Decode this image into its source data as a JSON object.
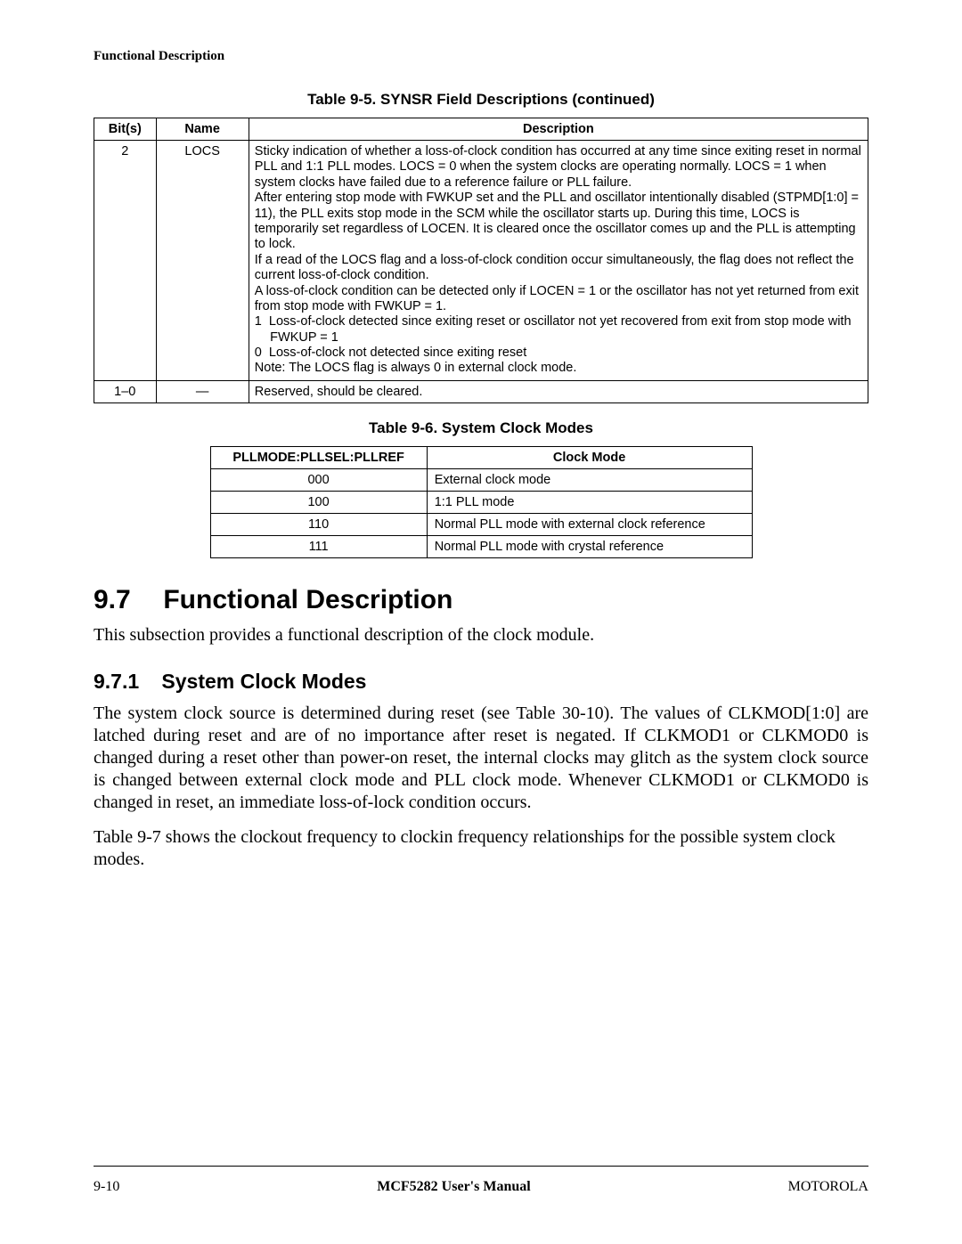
{
  "running_head": "Functional Description",
  "table5": {
    "caption": "Table 9-5. SYNSR Field Descriptions (continued)",
    "headers": {
      "bits": "Bit(s)",
      "name": "Name",
      "desc": "Description"
    },
    "rows": [
      {
        "bits": "2",
        "name": "LOCS",
        "desc": {
          "p1": "Sticky indication of whether a loss-of-clock condition has occurred at any time since exiting reset in normal PLL and 1:1 PLL modes. LOCS = 0 when the system clocks are operating normally. LOCS = 1 when system clocks have failed due to a reference failure or PLL failure.",
          "p2": "After entering stop mode with FWKUP set and the PLL and oscillator intentionally disabled (STPMD[1:0] = 11), the PLL exits stop mode in the SCM while the oscillator starts up. During this time, LOCS is temporarily set regardless of LOCEN. It is cleared once the oscillator comes up and the PLL is attempting to lock.",
          "p3": "If a read of the LOCS flag and a loss-of-clock condition occur simultaneously, the flag does not reflect the current loss-of-clock condition.",
          "p4": "A loss-of-clock condition can be detected only if LOCEN = 1 or the oscillator has not yet returned from exit from stop mode with FWKUP = 1.",
          "li1_key": "1",
          "li1": "Loss-of-clock detected since exiting reset or oscillator not yet recovered from exit from stop mode with FWKUP = 1",
          "li0_key": "0",
          "li0": "Loss-of-clock not detected since exiting reset",
          "note": "Note: The LOCS flag is always 0 in external clock mode."
        }
      },
      {
        "bits": "1–0",
        "name": "—",
        "desc_plain": "Reserved, should be cleared."
      }
    ]
  },
  "table6": {
    "caption": "Table 9-6.  System Clock Modes",
    "headers": {
      "col1": "PLLMODE:PLLSEL:PLLREF",
      "col2": "Clock Mode"
    },
    "rows": [
      {
        "code": "000",
        "mode": "External clock mode"
      },
      {
        "code": "100",
        "mode": "1:1 PLL mode"
      },
      {
        "code": "110",
        "mode": "Normal PLL mode with external clock reference"
      },
      {
        "code": "111",
        "mode": "Normal PLL mode with crystal reference"
      }
    ]
  },
  "section": {
    "num": "9.7",
    "title": "Functional Description",
    "intro": "This subsection provides a functional description of the clock module."
  },
  "subsection": {
    "num": "9.7.1",
    "title": "System Clock Modes",
    "p1": "The system clock source is determined during reset (see Table 30-10). The values of CLKMOD[1:0] are latched during reset and are of no importance after reset is negated. If CLKMOD1 or CLKMOD0 is changed during a reset other than power-on reset, the internal clocks may glitch as the system clock source is changed between external clock mode and PLL clock mode. Whenever CLKMOD1 or CLKMOD0 is changed in reset, an immediate loss-of-lock condition occurs.",
    "p2": "Table 9-7 shows the clockout frequency to clockin frequency relationships for the possible system clock modes."
  },
  "footer": {
    "left": "9-10",
    "center": "MCF5282 User's Manual",
    "right": "MOTOROLA"
  }
}
